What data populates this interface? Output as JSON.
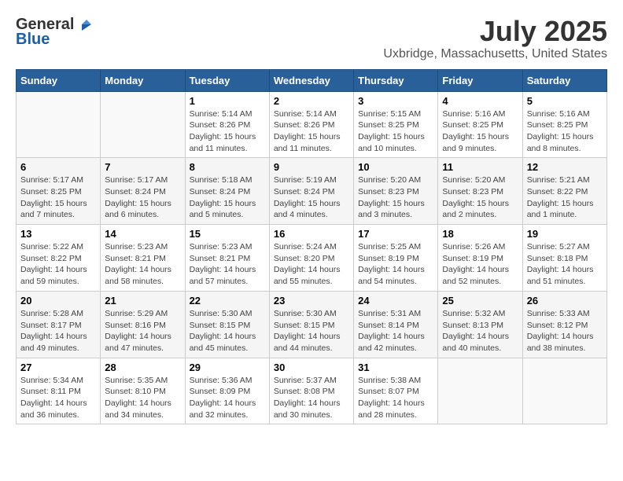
{
  "logo": {
    "general": "General",
    "blue": "Blue"
  },
  "title": "July 2025",
  "subtitle": "Uxbridge, Massachusetts, United States",
  "days_of_week": [
    "Sunday",
    "Monday",
    "Tuesday",
    "Wednesday",
    "Thursday",
    "Friday",
    "Saturday"
  ],
  "weeks": [
    [
      {
        "day": "",
        "info": ""
      },
      {
        "day": "",
        "info": ""
      },
      {
        "day": "1",
        "info": "Sunrise: 5:14 AM\nSunset: 8:26 PM\nDaylight: 15 hours\nand 11 minutes."
      },
      {
        "day": "2",
        "info": "Sunrise: 5:14 AM\nSunset: 8:26 PM\nDaylight: 15 hours\nand 11 minutes."
      },
      {
        "day": "3",
        "info": "Sunrise: 5:15 AM\nSunset: 8:25 PM\nDaylight: 15 hours\nand 10 minutes."
      },
      {
        "day": "4",
        "info": "Sunrise: 5:16 AM\nSunset: 8:25 PM\nDaylight: 15 hours\nand 9 minutes."
      },
      {
        "day": "5",
        "info": "Sunrise: 5:16 AM\nSunset: 8:25 PM\nDaylight: 15 hours\nand 8 minutes."
      }
    ],
    [
      {
        "day": "6",
        "info": "Sunrise: 5:17 AM\nSunset: 8:25 PM\nDaylight: 15 hours\nand 7 minutes."
      },
      {
        "day": "7",
        "info": "Sunrise: 5:17 AM\nSunset: 8:24 PM\nDaylight: 15 hours\nand 6 minutes."
      },
      {
        "day": "8",
        "info": "Sunrise: 5:18 AM\nSunset: 8:24 PM\nDaylight: 15 hours\nand 5 minutes."
      },
      {
        "day": "9",
        "info": "Sunrise: 5:19 AM\nSunset: 8:24 PM\nDaylight: 15 hours\nand 4 minutes."
      },
      {
        "day": "10",
        "info": "Sunrise: 5:20 AM\nSunset: 8:23 PM\nDaylight: 15 hours\nand 3 minutes."
      },
      {
        "day": "11",
        "info": "Sunrise: 5:20 AM\nSunset: 8:23 PM\nDaylight: 15 hours\nand 2 minutes."
      },
      {
        "day": "12",
        "info": "Sunrise: 5:21 AM\nSunset: 8:22 PM\nDaylight: 15 hours\nand 1 minute."
      }
    ],
    [
      {
        "day": "13",
        "info": "Sunrise: 5:22 AM\nSunset: 8:22 PM\nDaylight: 14 hours\nand 59 minutes."
      },
      {
        "day": "14",
        "info": "Sunrise: 5:23 AM\nSunset: 8:21 PM\nDaylight: 14 hours\nand 58 minutes."
      },
      {
        "day": "15",
        "info": "Sunrise: 5:23 AM\nSunset: 8:21 PM\nDaylight: 14 hours\nand 57 minutes."
      },
      {
        "day": "16",
        "info": "Sunrise: 5:24 AM\nSunset: 8:20 PM\nDaylight: 14 hours\nand 55 minutes."
      },
      {
        "day": "17",
        "info": "Sunrise: 5:25 AM\nSunset: 8:19 PM\nDaylight: 14 hours\nand 54 minutes."
      },
      {
        "day": "18",
        "info": "Sunrise: 5:26 AM\nSunset: 8:19 PM\nDaylight: 14 hours\nand 52 minutes."
      },
      {
        "day": "19",
        "info": "Sunrise: 5:27 AM\nSunset: 8:18 PM\nDaylight: 14 hours\nand 51 minutes."
      }
    ],
    [
      {
        "day": "20",
        "info": "Sunrise: 5:28 AM\nSunset: 8:17 PM\nDaylight: 14 hours\nand 49 minutes."
      },
      {
        "day": "21",
        "info": "Sunrise: 5:29 AM\nSunset: 8:16 PM\nDaylight: 14 hours\nand 47 minutes."
      },
      {
        "day": "22",
        "info": "Sunrise: 5:30 AM\nSunset: 8:15 PM\nDaylight: 14 hours\nand 45 minutes."
      },
      {
        "day": "23",
        "info": "Sunrise: 5:30 AM\nSunset: 8:15 PM\nDaylight: 14 hours\nand 44 minutes."
      },
      {
        "day": "24",
        "info": "Sunrise: 5:31 AM\nSunset: 8:14 PM\nDaylight: 14 hours\nand 42 minutes."
      },
      {
        "day": "25",
        "info": "Sunrise: 5:32 AM\nSunset: 8:13 PM\nDaylight: 14 hours\nand 40 minutes."
      },
      {
        "day": "26",
        "info": "Sunrise: 5:33 AM\nSunset: 8:12 PM\nDaylight: 14 hours\nand 38 minutes."
      }
    ],
    [
      {
        "day": "27",
        "info": "Sunrise: 5:34 AM\nSunset: 8:11 PM\nDaylight: 14 hours\nand 36 minutes."
      },
      {
        "day": "28",
        "info": "Sunrise: 5:35 AM\nSunset: 8:10 PM\nDaylight: 14 hours\nand 34 minutes."
      },
      {
        "day": "29",
        "info": "Sunrise: 5:36 AM\nSunset: 8:09 PM\nDaylight: 14 hours\nand 32 minutes."
      },
      {
        "day": "30",
        "info": "Sunrise: 5:37 AM\nSunset: 8:08 PM\nDaylight: 14 hours\nand 30 minutes."
      },
      {
        "day": "31",
        "info": "Sunrise: 5:38 AM\nSunset: 8:07 PM\nDaylight: 14 hours\nand 28 minutes."
      },
      {
        "day": "",
        "info": ""
      },
      {
        "day": "",
        "info": ""
      }
    ]
  ]
}
